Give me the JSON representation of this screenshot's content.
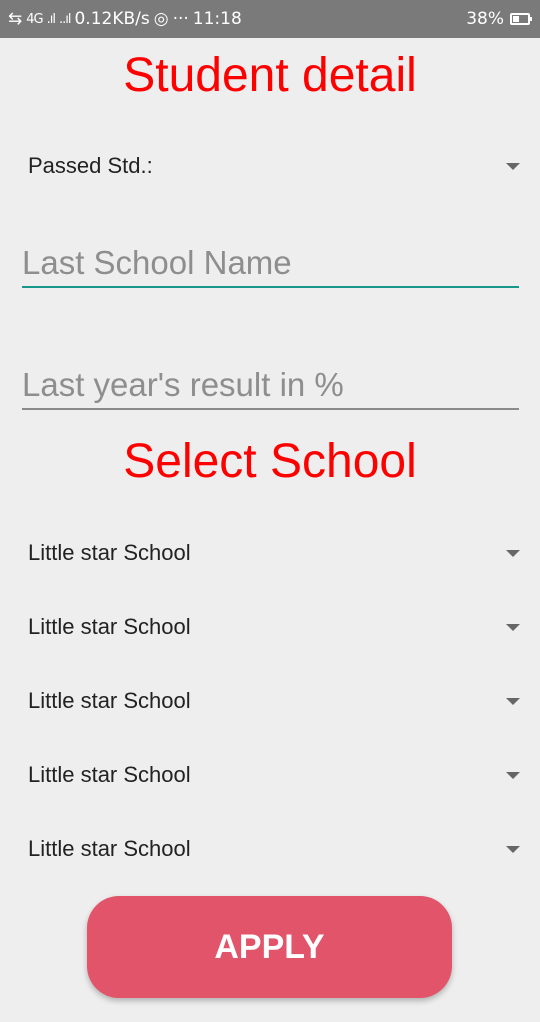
{
  "status_bar": {
    "signal_text": "4G",
    "speed": "0.12KB/s",
    "dots": "···",
    "time": "11:18",
    "battery_percent": "38%",
    "battery_level": 0.38
  },
  "header": {
    "title": "Student detail"
  },
  "passed_std": {
    "label": "Passed Std.:"
  },
  "last_school": {
    "placeholder": "Last School Name",
    "value": ""
  },
  "last_result": {
    "placeholder": "Last year's result in %",
    "value": ""
  },
  "select_school": {
    "title": "Select School",
    "spinners": [
      {
        "label": "Little star School"
      },
      {
        "label": "Little star School"
      },
      {
        "label": "Little star School"
      },
      {
        "label": "Little star School"
      },
      {
        "label": "Little star School"
      }
    ]
  },
  "apply_button": {
    "label": "APPLY",
    "color": "#e2546a"
  },
  "colors": {
    "accent": "#ff0000",
    "input_focus": "#17988c"
  }
}
